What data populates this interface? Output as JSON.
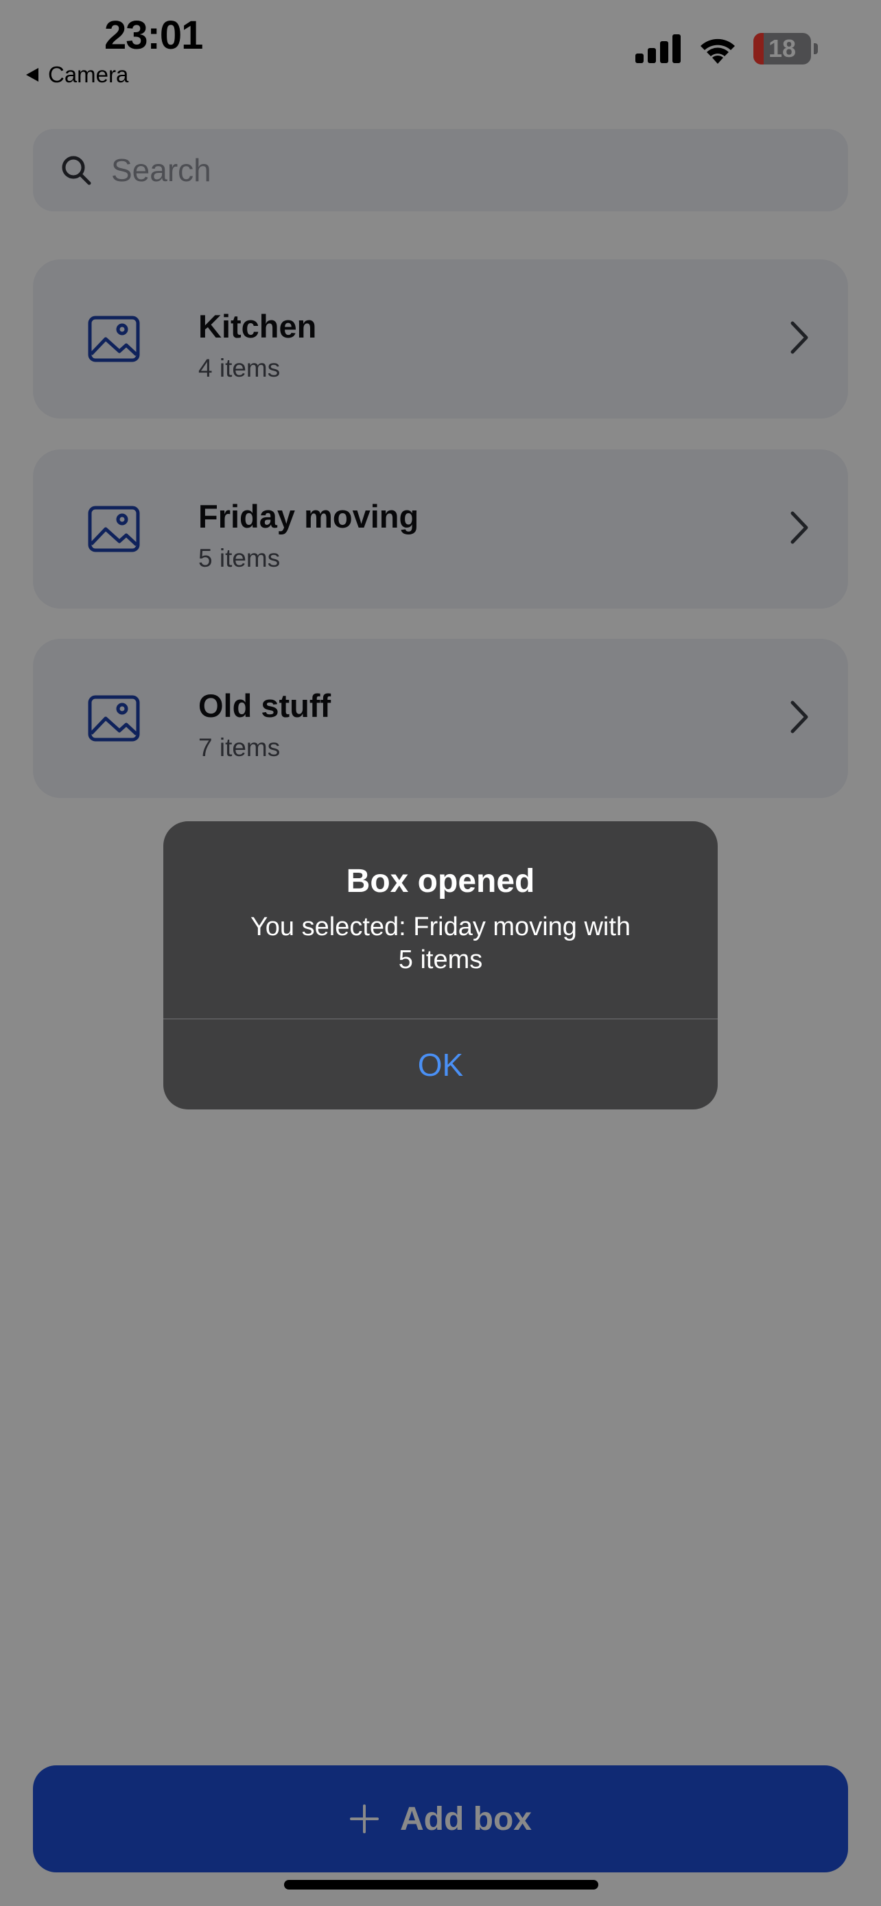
{
  "status_bar": {
    "time": "23:01",
    "back_app": "Camera",
    "battery_level": "18"
  },
  "search": {
    "placeholder": "Search",
    "value": ""
  },
  "boxes": [
    {
      "name": "Kitchen",
      "count": "4 items"
    },
    {
      "name": "Friday moving",
      "count": "5 items"
    },
    {
      "name": "Old stuff",
      "count": "7 items"
    }
  ],
  "add_button": {
    "label": "Add box"
  },
  "alert": {
    "title": "Box opened",
    "message": "You selected: Friday moving with 5 items",
    "ok_label": "OK"
  },
  "colors": {
    "accent": "#1f4fd6",
    "icon_blue": "#1d3fa8",
    "alert_bg": "#3f3f40",
    "alert_button": "#4a90f5",
    "card_bg": "#eef0f6"
  },
  "icons": {
    "thumbnail": "image-icon",
    "row_disclosure": "chevron-right-icon",
    "search": "search-icon",
    "add": "plus-icon"
  }
}
